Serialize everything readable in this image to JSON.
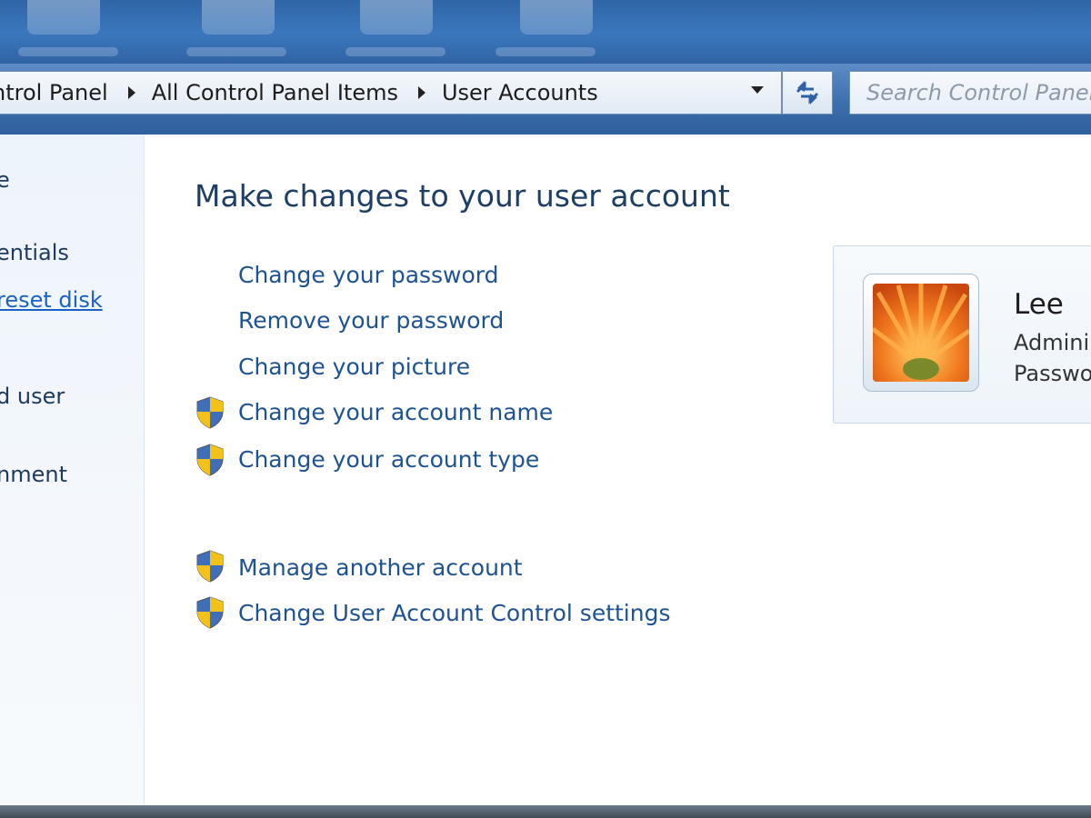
{
  "breadcrumb": {
    "items": [
      "ntrol Panel",
      "All Control Panel Items",
      "User Accounts"
    ]
  },
  "search": {
    "placeholder": "Search Control Panel"
  },
  "sidebar": {
    "items": [
      "e",
      "entials",
      "reset disk",
      "d user",
      "nment"
    ]
  },
  "main": {
    "heading": "Make changes to your user account",
    "tasks": [
      "Change your password",
      "Remove your password",
      "Change your picture",
      "Change your account name",
      "Change your account type"
    ],
    "other_tasks": [
      "Manage another account",
      "Change User Account Control settings"
    ]
  },
  "user_card": {
    "name": "Lee",
    "type": "Admini",
    "password_status": "Passwo"
  },
  "icons": {
    "shield": "uac-shield-icon",
    "refresh": "refresh-icon",
    "dropdown": "chevron-down-icon",
    "avatar": "flower-picture"
  },
  "colors": {
    "link": "#1e5291",
    "heading": "#1e3e66",
    "title_bar": "#3d6fae"
  }
}
